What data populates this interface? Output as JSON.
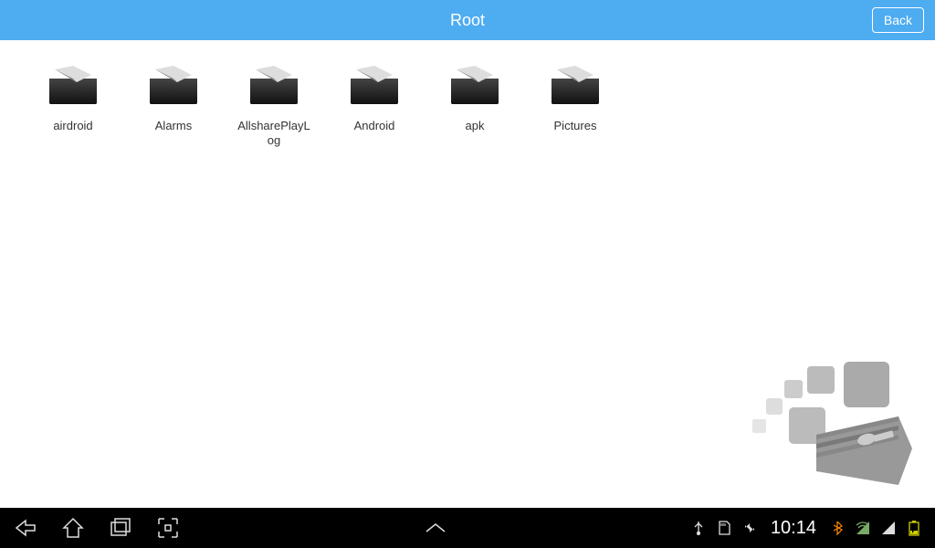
{
  "header": {
    "title": "Root",
    "back_label": "Back"
  },
  "folders": [
    {
      "name": "airdroid"
    },
    {
      "name": "Alarms"
    },
    {
      "name": "AllsharePlayLog"
    },
    {
      "name": "Android"
    },
    {
      "name": "apk"
    },
    {
      "name": "Pictures"
    }
  ],
  "status": {
    "time": "10:14"
  }
}
